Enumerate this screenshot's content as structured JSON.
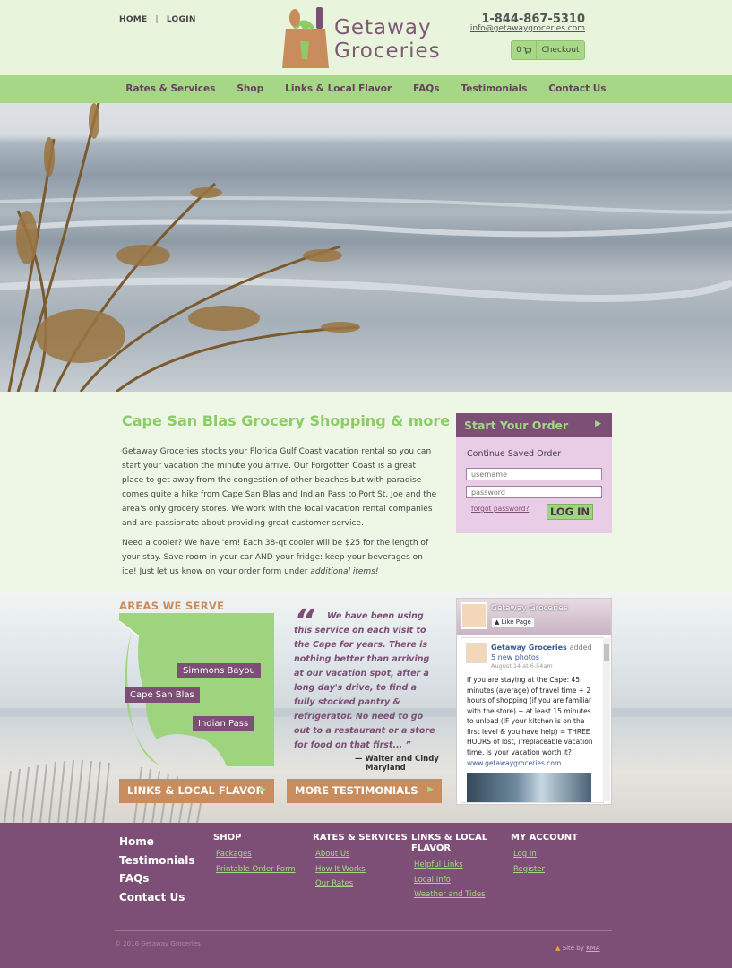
{
  "header": {
    "top_links": [
      "HOME",
      "LOGIN"
    ],
    "separator": "|",
    "logo_text_line1": "Getaway",
    "logo_text_line2": "Groceries",
    "phone": "1-844-867-5310",
    "email": "info@getawaygroceries.com",
    "cart_count": "0",
    "checkout_label": "Checkout"
  },
  "nav": {
    "items": [
      "Rates & Services",
      "Shop",
      "Links & Local Flavor",
      "FAQs",
      "Testimonials",
      "Contact Us"
    ]
  },
  "main": {
    "title": "Cape San Blas Grocery Shopping & more",
    "paragraph1": "Getaway Groceries stocks your Florida Gulf Coast vacation rental so you can start your vacation the minute you arrive. Our Forgotten Coast is a great place to get away from the congestion of other beaches but with paradise comes quite a hike from Cape San Blas and Indian Pass to Port St. Joe and the area's only grocery stores. We work with the local vacation rental companies and are passionate about providing great customer service.",
    "paragraph2_start": "Need a cooler?  We have 'em!  Each 38-qt cooler will be $25 for the length of your stay.  Save room in your car AND your fridge:  keep your beverages on ice!  Just let us know on your order form under ",
    "paragraph2_emphasis": "additional items!"
  },
  "order": {
    "heading": "Start Your Order",
    "subheading": "Continue Saved Order",
    "username_placeholder": "username",
    "password_placeholder": "password",
    "forgot_label": "forgot password?",
    "login_label": "LOG IN"
  },
  "areas": {
    "title": "AREAS WE SERVE",
    "labels": [
      "Simmons Bayou",
      "Cape San Blas",
      "Indian Pass"
    ]
  },
  "testimonial": {
    "quote_mark": "“",
    "text": "We have been using this service on each visit to the Cape for years. There is nothing better than arriving at our vacation spot, after a long day's drive, to find a fully stocked pantry & refrigerator. No need to go out to a restaurant or a store for food on that first... ”",
    "author_line1": "— Walter and Cindy",
    "author_line2": "Maryland"
  },
  "buttons": {
    "links_label": "LINKS & LOCAL FLAVOR",
    "testimonials_label": "MORE TESTIMONIALS"
  },
  "facebook": {
    "page_name": "Getaway Groceries",
    "like_label": "Like Page",
    "post_author": "Getaway Groceries",
    "post_added": "added",
    "post_photos": "5 new photos",
    "post_date": "August 14 at 6:54am",
    "post_text": "If you are staying at the Cape: 45 minutes (average) of travel time + 2 hours of shopping (if you are familiar with the store) + at least 15 minutes to unload (IF your kitchen is on the first level & you have help) = THREE HOURS of lost, irreplaceable vacation time. Is your vacation worth it?",
    "post_link": "www.getawaygroceries.com"
  },
  "footer": {
    "main_links": [
      "Home",
      "Testimonials",
      "FAQs",
      "Contact Us"
    ],
    "columns": [
      {
        "heading": "SHOP",
        "links": [
          "Packages",
          "Printable Order Form"
        ]
      },
      {
        "heading": "RATES & SERVICES",
        "links": [
          "About Us",
          "How It Works",
          "Our Rates"
        ]
      },
      {
        "heading": "LINKS & LOCAL FLAVOR",
        "links": [
          "Helpful Links",
          "Local Info",
          "Weather and Tides"
        ]
      },
      {
        "heading": "MY ACCOUNT",
        "links": [
          "Log In",
          "Register"
        ]
      }
    ],
    "copyright": "© 2016 Getaway Groceries",
    "site_by": "Site by",
    "site_by_link": "KMA"
  },
  "colors": {
    "brand_purple": "#7d4f76",
    "brand_green": "#a6d787",
    "accent_orange": "#c98c5c"
  }
}
